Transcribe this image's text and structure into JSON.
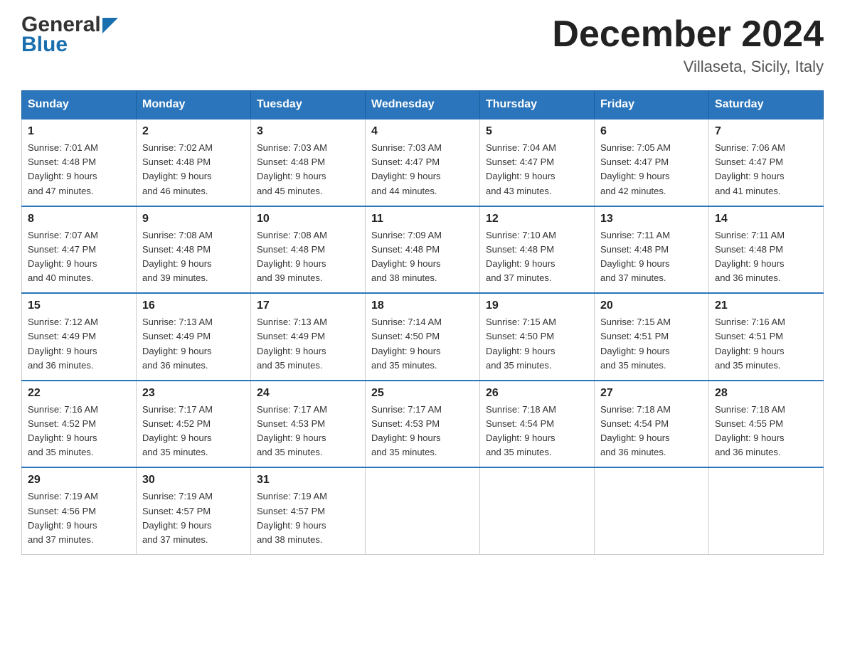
{
  "header": {
    "logo_general": "General",
    "logo_blue": "Blue",
    "month_title": "December 2024",
    "location": "Villaseta, Sicily, Italy"
  },
  "days_of_week": [
    "Sunday",
    "Monday",
    "Tuesday",
    "Wednesday",
    "Thursday",
    "Friday",
    "Saturday"
  ],
  "weeks": [
    [
      {
        "day": "1",
        "sunrise": "7:01 AM",
        "sunset": "4:48 PM",
        "daylight": "9 hours and 47 minutes."
      },
      {
        "day": "2",
        "sunrise": "7:02 AM",
        "sunset": "4:48 PM",
        "daylight": "9 hours and 46 minutes."
      },
      {
        "day": "3",
        "sunrise": "7:03 AM",
        "sunset": "4:48 PM",
        "daylight": "9 hours and 45 minutes."
      },
      {
        "day": "4",
        "sunrise": "7:03 AM",
        "sunset": "4:47 PM",
        "daylight": "9 hours and 44 minutes."
      },
      {
        "day": "5",
        "sunrise": "7:04 AM",
        "sunset": "4:47 PM",
        "daylight": "9 hours and 43 minutes."
      },
      {
        "day": "6",
        "sunrise": "7:05 AM",
        "sunset": "4:47 PM",
        "daylight": "9 hours and 42 minutes."
      },
      {
        "day": "7",
        "sunrise": "7:06 AM",
        "sunset": "4:47 PM",
        "daylight": "9 hours and 41 minutes."
      }
    ],
    [
      {
        "day": "8",
        "sunrise": "7:07 AM",
        "sunset": "4:47 PM",
        "daylight": "9 hours and 40 minutes."
      },
      {
        "day": "9",
        "sunrise": "7:08 AM",
        "sunset": "4:48 PM",
        "daylight": "9 hours and 39 minutes."
      },
      {
        "day": "10",
        "sunrise": "7:08 AM",
        "sunset": "4:48 PM",
        "daylight": "9 hours and 39 minutes."
      },
      {
        "day": "11",
        "sunrise": "7:09 AM",
        "sunset": "4:48 PM",
        "daylight": "9 hours and 38 minutes."
      },
      {
        "day": "12",
        "sunrise": "7:10 AM",
        "sunset": "4:48 PM",
        "daylight": "9 hours and 37 minutes."
      },
      {
        "day": "13",
        "sunrise": "7:11 AM",
        "sunset": "4:48 PM",
        "daylight": "9 hours and 37 minutes."
      },
      {
        "day": "14",
        "sunrise": "7:11 AM",
        "sunset": "4:48 PM",
        "daylight": "9 hours and 36 minutes."
      }
    ],
    [
      {
        "day": "15",
        "sunrise": "7:12 AM",
        "sunset": "4:49 PM",
        "daylight": "9 hours and 36 minutes."
      },
      {
        "day": "16",
        "sunrise": "7:13 AM",
        "sunset": "4:49 PM",
        "daylight": "9 hours and 36 minutes."
      },
      {
        "day": "17",
        "sunrise": "7:13 AM",
        "sunset": "4:49 PM",
        "daylight": "9 hours and 35 minutes."
      },
      {
        "day": "18",
        "sunrise": "7:14 AM",
        "sunset": "4:50 PM",
        "daylight": "9 hours and 35 minutes."
      },
      {
        "day": "19",
        "sunrise": "7:15 AM",
        "sunset": "4:50 PM",
        "daylight": "9 hours and 35 minutes."
      },
      {
        "day": "20",
        "sunrise": "7:15 AM",
        "sunset": "4:51 PM",
        "daylight": "9 hours and 35 minutes."
      },
      {
        "day": "21",
        "sunrise": "7:16 AM",
        "sunset": "4:51 PM",
        "daylight": "9 hours and 35 minutes."
      }
    ],
    [
      {
        "day": "22",
        "sunrise": "7:16 AM",
        "sunset": "4:52 PM",
        "daylight": "9 hours and 35 minutes."
      },
      {
        "day": "23",
        "sunrise": "7:17 AM",
        "sunset": "4:52 PM",
        "daylight": "9 hours and 35 minutes."
      },
      {
        "day": "24",
        "sunrise": "7:17 AM",
        "sunset": "4:53 PM",
        "daylight": "9 hours and 35 minutes."
      },
      {
        "day": "25",
        "sunrise": "7:17 AM",
        "sunset": "4:53 PM",
        "daylight": "9 hours and 35 minutes."
      },
      {
        "day": "26",
        "sunrise": "7:18 AM",
        "sunset": "4:54 PM",
        "daylight": "9 hours and 35 minutes."
      },
      {
        "day": "27",
        "sunrise": "7:18 AM",
        "sunset": "4:54 PM",
        "daylight": "9 hours and 36 minutes."
      },
      {
        "day": "28",
        "sunrise": "7:18 AM",
        "sunset": "4:55 PM",
        "daylight": "9 hours and 36 minutes."
      }
    ],
    [
      {
        "day": "29",
        "sunrise": "7:19 AM",
        "sunset": "4:56 PM",
        "daylight": "9 hours and 37 minutes."
      },
      {
        "day": "30",
        "sunrise": "7:19 AM",
        "sunset": "4:57 PM",
        "daylight": "9 hours and 37 minutes."
      },
      {
        "day": "31",
        "sunrise": "7:19 AM",
        "sunset": "4:57 PM",
        "daylight": "9 hours and 38 minutes."
      },
      null,
      null,
      null,
      null
    ]
  ],
  "labels": {
    "sunrise_prefix": "Sunrise: ",
    "sunset_prefix": "Sunset: ",
    "daylight_prefix": "Daylight: "
  }
}
